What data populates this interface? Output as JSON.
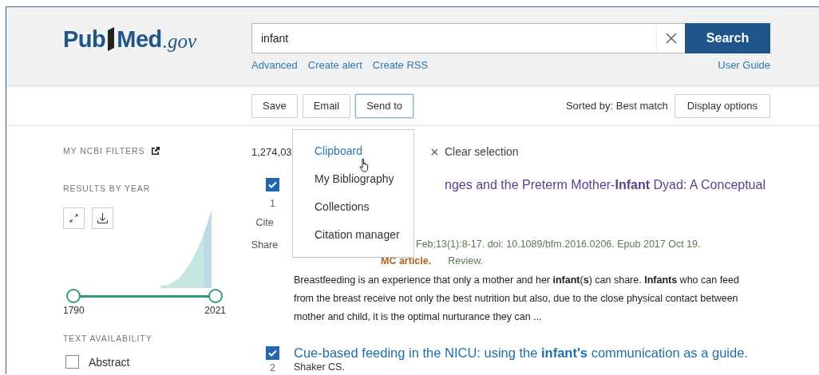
{
  "logo": {
    "parts": [
      "Pub",
      "Med"
    ],
    "domain": ".gov"
  },
  "search": {
    "value": "infant",
    "button": "Search"
  },
  "search_links": [
    "Advanced",
    "Create alert",
    "Create RSS"
  ],
  "user_guide": "User Guide",
  "toolbar": {
    "buttons": [
      {
        "label": "Save",
        "focused": false
      },
      {
        "label": "Email",
        "focused": false
      },
      {
        "label": "Send to",
        "focused": true
      }
    ],
    "sort_label": "Sorted by: Best match",
    "display_button": "Display options"
  },
  "sidebar": {
    "filters_heading": "MY NCBI FILTERS",
    "year_heading": "RESULTS BY YEAR",
    "year_slider": {
      "start": "1790",
      "end": "2021",
      "handles": [
        {
          "level": 0
        },
        {
          "level": 1
        }
      ]
    },
    "availability_heading": "TEXT AVAILABILITY",
    "filters": [
      {
        "label": "Abstract",
        "checked": false
      }
    ]
  },
  "results": {
    "count": "1,274,03",
    "clear_selection": "Clear selection",
    "items": [
      {
        "checked": true,
        "number": "1",
        "actions": [
          "Cite",
          "Share"
        ],
        "title": "nges and the Preterm Mother-**Infant** Dyad: A Conceptual",
        "visited": true,
        "citation": "Feb;13(1):8-17. doi: 10.1089/bfm.2016.0206. Epub 2017 Oct 19.",
        "free_text": "MC article.",
        "type": "Review.",
        "snippet": "Breastfeeding is an experience that only a mother and her **infant**(**s**) can share. **Infants** who can feed from the breast receive not only the best nutrition but also, due to the close physical contact between mother and child, it is the optimal nurturance they can ..."
      },
      {
        "checked": true,
        "number": "2",
        "title": "Cue-based feeding in the NICU: using the **infant's** communication as a guide.",
        "visited": false,
        "authors": "Shaker CS."
      }
    ]
  },
  "send_to_menu": [
    {
      "label": "Clipboard",
      "hovered": true
    },
    {
      "label": "My Bibliography",
      "hovered": false
    },
    {
      "label": "Collections",
      "hovered": false
    },
    {
      "label": "Citation manager",
      "hovered": false
    }
  ]
}
